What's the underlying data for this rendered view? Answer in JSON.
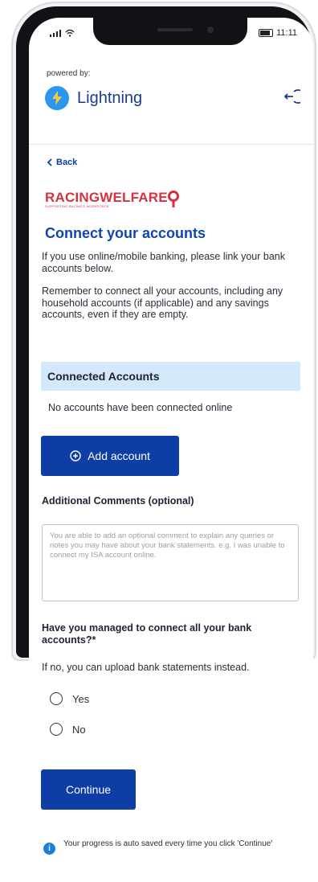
{
  "status_bar": {
    "time": "11:11"
  },
  "header": {
    "powered_by": "powered by:",
    "brand": "Lightning",
    "logout_icon": "logout-icon"
  },
  "nav": {
    "back_label": "Back"
  },
  "partner": {
    "name": "RACINGWELFARE",
    "tagline": "SUPPORTING RACING'S WORKFORCE",
    "color": "#d6313f"
  },
  "page": {
    "title": "Connect your accounts",
    "intro_1": "If you use online/mobile banking, please link your bank accounts below.",
    "intro_2": "Remember to connect all your accounts, including any household accounts (if applicable) and any savings accounts, even if they are empty."
  },
  "connected_accounts": {
    "heading": "Connected Accounts",
    "empty_text": "No accounts have been connected online"
  },
  "add_account_button": "Add account",
  "comments": {
    "label": "Additional Comments (optional)",
    "placeholder": "You are able to add an optional comment to explain any queries or notes you may have about your bank statements. e.g. I was unable to connect my ISA account online."
  },
  "question": {
    "label": "Have you managed to connect all your bank accounts?*",
    "help": "If no, you can upload bank statements instead.",
    "options": [
      "Yes",
      "No"
    ]
  },
  "continue_button": "Continue",
  "info_note": "Your progress is auto saved every time you click 'Continue'",
  "colors": {
    "primary": "#0d3ea6",
    "accent_light": "#d3e8fb",
    "lightning": "#2d96ee"
  }
}
